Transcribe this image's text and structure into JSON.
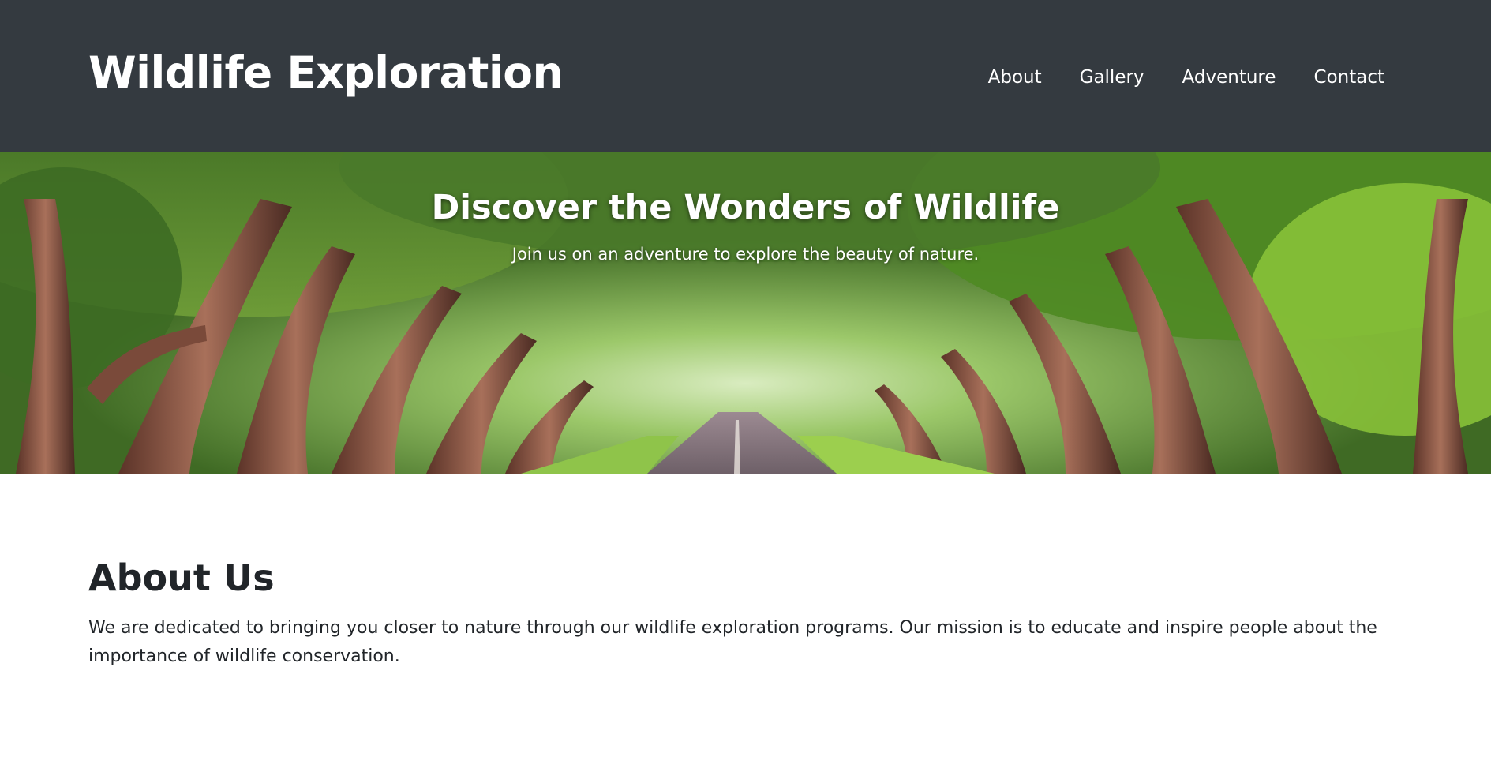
{
  "header": {
    "brand": "Wildlife Exploration",
    "nav": [
      {
        "label": "About"
      },
      {
        "label": "Gallery"
      },
      {
        "label": "Adventure"
      },
      {
        "label": "Contact"
      }
    ]
  },
  "hero": {
    "title": "Discover the Wonders of Wildlife",
    "subtitle": "Join us on an adventure to explore the beauty of nature."
  },
  "about": {
    "heading": "About Us",
    "body": "We are dedicated to bringing you closer to nature through our wildlife exploration programs. Our mission is to educate and inspire people about the importance of wildlife conservation."
  },
  "colors": {
    "header_bg": "#343a40",
    "text_dark": "#212529",
    "white": "#ffffff"
  }
}
